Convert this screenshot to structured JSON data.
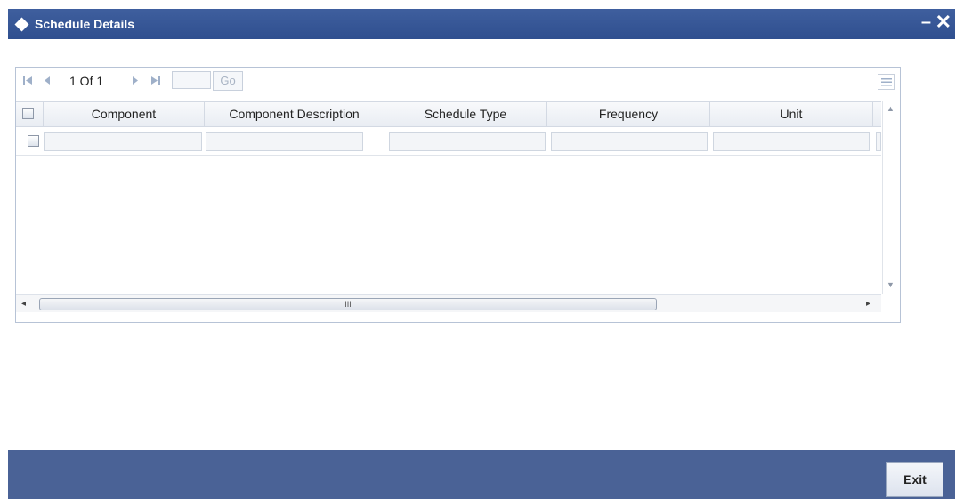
{
  "window": {
    "title": "Schedule Details",
    "minimize_glyph": "–",
    "close_glyph": "✕"
  },
  "navigation": {
    "page_text": "1 Of 1",
    "go_label": "Go",
    "page_input_value": ""
  },
  "grid": {
    "columns": [
      "Component",
      "Component Description",
      "Schedule Type",
      "Frequency",
      "Unit"
    ],
    "scrollbar_thumb_glyph": "III"
  },
  "footer": {
    "exit_label": "Exit"
  },
  "colors": {
    "title_bar": "#2f4f8f",
    "footer": "#4a6296"
  }
}
